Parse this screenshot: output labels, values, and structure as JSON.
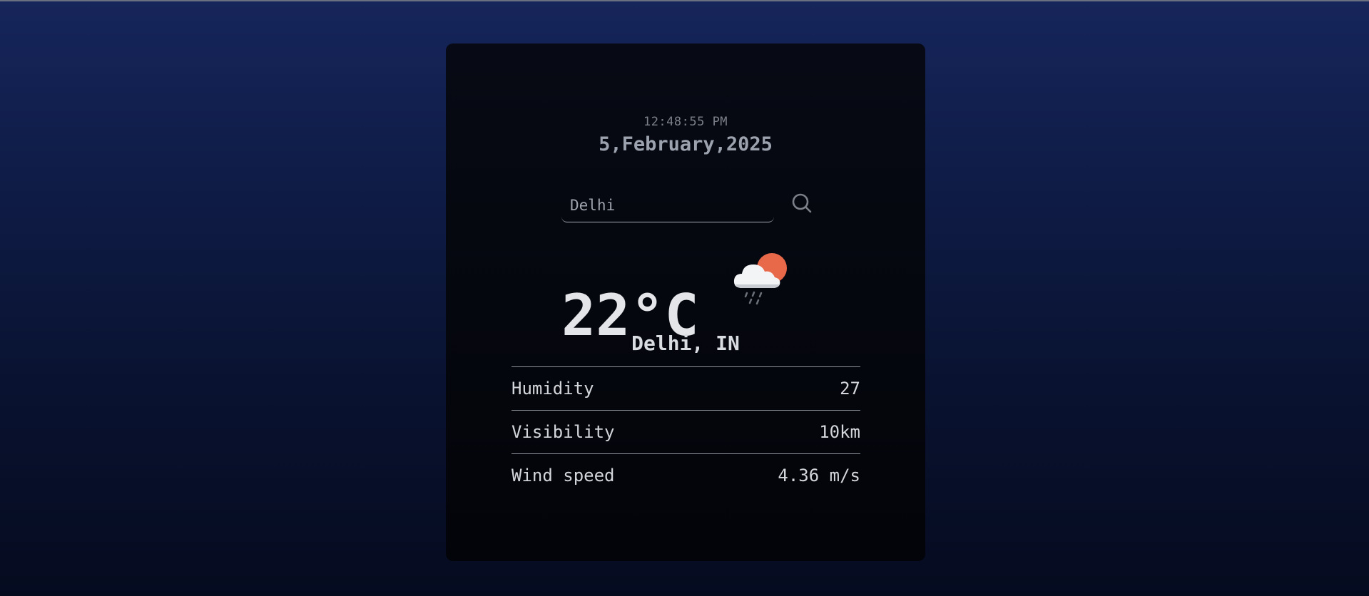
{
  "clock": {
    "time": "12:48:55 PM",
    "date": "5,February,2025"
  },
  "search": {
    "value": "Delhi",
    "placeholder": "Delhi",
    "icon": "search-icon"
  },
  "weather": {
    "temperature": "22°C",
    "icon": "cloud-rain-sun-icon",
    "location": "Delhi, IN"
  },
  "details": [
    {
      "label": "Humidity",
      "value": "27"
    },
    {
      "label": "Visibility",
      "value": "10km"
    },
    {
      "label": "Wind speed",
      "value": "4.36 m/s"
    }
  ],
  "colors": {
    "background_top": "#16255b",
    "background_bottom": "#050b1f",
    "card": "#05070f",
    "sun": "#e8694a"
  }
}
